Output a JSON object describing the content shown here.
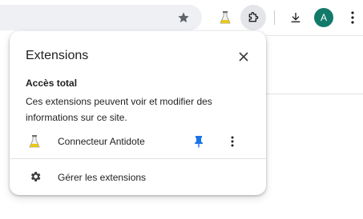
{
  "toolbar": {
    "avatar_initial": "A",
    "icons": [
      "star-icon",
      "flask-icon",
      "puzzle-icon",
      "download-icon",
      "more-vert-icon"
    ]
  },
  "popup": {
    "title": "Extensions",
    "section_title": "Accès total",
    "section_desc": "Ces extensions peuvent voir et modifier des informations sur ce site.",
    "extension": {
      "name": "Connecteur Antidote",
      "pin_color": "#1a73e8"
    },
    "manage_label": "Gérer les extensions"
  },
  "colors": {
    "accent": "#1a73e8",
    "avatar_bg": "#137a6a",
    "omnibox_bg": "#eef0f4"
  }
}
